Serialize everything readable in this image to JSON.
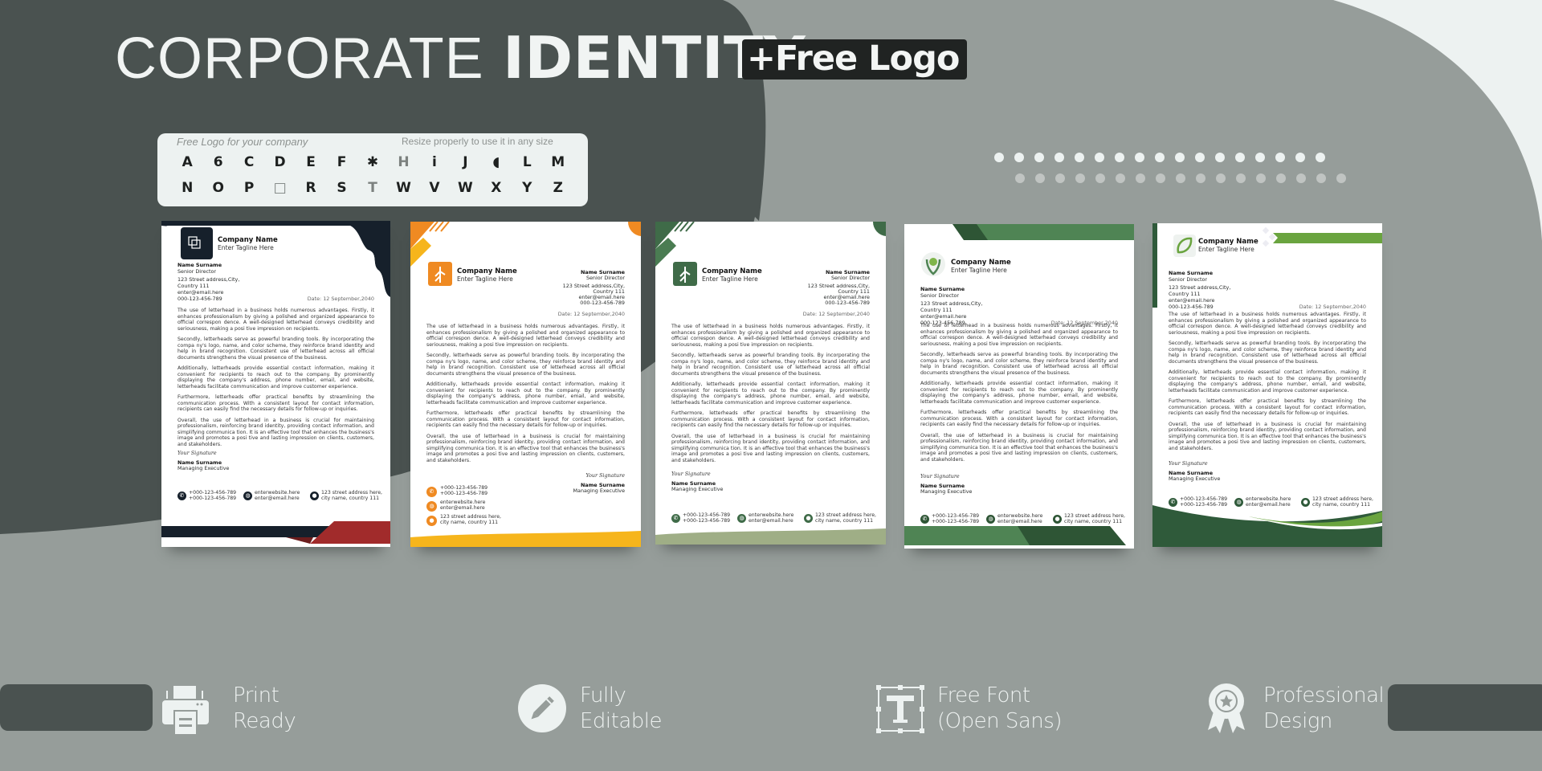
{
  "header": {
    "title_light": "CORPORATE",
    "title_bold": "IDENTITY",
    "badge": "+Free Logo"
  },
  "colors": {
    "background_dark": "#4a5250",
    "background_mid": "#969d9a",
    "background_light": "#edf2f1",
    "badge_bg": "#202322"
  },
  "logo_panel": {
    "caption_left": "Free Logo for your company",
    "caption_right": "Resize properly to use it in any size",
    "logos": [
      {
        "icon": "a-triangle-logo",
        "glyph": "A"
      },
      {
        "icon": "b-swirl-logo",
        "glyph": "6"
      },
      {
        "icon": "c-moon-logo",
        "glyph": "C"
      },
      {
        "icon": "d-outline-logo",
        "glyph": "D"
      },
      {
        "icon": "e-stripes-logo",
        "glyph": "E"
      },
      {
        "icon": "f-block-logo",
        "glyph": "F"
      },
      {
        "icon": "flower-logo",
        "glyph": "✱"
      },
      {
        "icon": "h-block-logo",
        "glyph": "H"
      },
      {
        "icon": "i-circle-logo",
        "glyph": "i"
      },
      {
        "icon": "j-logo",
        "glyph": "J"
      },
      {
        "icon": "k-half-circle-logo",
        "glyph": "◖"
      },
      {
        "icon": "l-curve-logo",
        "glyph": "L"
      },
      {
        "icon": "m-stripes-logo",
        "glyph": "M"
      },
      {
        "icon": "n-arrows-logo",
        "glyph": "N"
      },
      {
        "icon": "o-ring-logo",
        "glyph": "O"
      },
      {
        "icon": "p-logo",
        "glyph": "P"
      },
      {
        "icon": "q-square-logo",
        "glyph": "□"
      },
      {
        "icon": "r-oval-logo",
        "glyph": "R"
      },
      {
        "icon": "s-logo",
        "glyph": "S"
      },
      {
        "icon": "t-logo",
        "glyph": "T"
      },
      {
        "icon": "u-stripes-logo",
        "glyph": "W"
      },
      {
        "icon": "v-heart-logo",
        "glyph": "V"
      },
      {
        "icon": "w-logo",
        "glyph": "W"
      },
      {
        "icon": "x-logo",
        "glyph": "X"
      },
      {
        "icon": "y-logo",
        "glyph": "Y"
      },
      {
        "icon": "z-logo",
        "glyph": "Z"
      }
    ]
  },
  "letterheads": [
    {
      "theme": "navy-red",
      "accent": "#16202b",
      "accent2": "#a12b2b",
      "company": "Company Name",
      "tagline": "Enter Tagline Here",
      "sender_name": "Name Surname",
      "sender_title": "Senior Director",
      "address_1": "123 Street address,City,",
      "address_2": "Country 111",
      "email": "enter@email.here",
      "phone": "000-123-456-789",
      "date": "Date: 12 September,2040",
      "signature": "Your Signature",
      "sign_name": "Name Surname",
      "sign_title": "Managing Executive",
      "contact_phone_1": "+000-123-456-789",
      "contact_phone_2": "+000-123-456-789",
      "contact_web": "enterwebsite.here",
      "contact_email": "enter@email.here",
      "contact_addr_1": "123 street address here,",
      "contact_addr_2": "city name, country 111"
    },
    {
      "theme": "orange",
      "accent": "#ef8a22",
      "accent2": "#f6b51c",
      "company": "Company Name",
      "tagline": "Enter Tagline Here",
      "sender_name": "Name Surname",
      "sender_title": "Senior Director",
      "address_1": "123 Street address,City,",
      "address_2": "Country 111",
      "email": "enter@email.here",
      "phone": "000-123-456-789",
      "date": "Date: 12 September,2040",
      "signature": "Your Signature",
      "sign_name": "Name Surname",
      "sign_title": "Managing Executive",
      "contact_phone_1": "+000-123-456-789",
      "contact_phone_2": "+000-123-456-789",
      "contact_web": "enterwebsite.here",
      "contact_email": "enter@email.here",
      "contact_addr_1": "123 street address here,",
      "contact_addr_2": "city name, country 111"
    },
    {
      "theme": "sage-green",
      "accent": "#3f6b48",
      "accent2": "#9fae86",
      "company": "Company Name",
      "tagline": "Enter Tagline Here",
      "sender_name": "Name Surname",
      "sender_title": "Senior Director",
      "address_1": "123 Street address,City,",
      "address_2": "Country 111",
      "email": "enter@email.here",
      "phone": "000-123-456-789",
      "date": "Date: 12 September,2040",
      "signature": "Your Signature",
      "sign_name": "Name Surname",
      "sign_title": "Managing Executive",
      "contact_phone_1": "+000-123-456-789",
      "contact_phone_2": "+000-123-456-789",
      "contact_web": "enterwebsite.here",
      "contact_email": "enter@email.here",
      "contact_addr_1": "123 street address here,",
      "contact_addr_2": "city name, country 111"
    },
    {
      "theme": "forest-green",
      "accent": "#4f8454",
      "accent2": "#2e5535",
      "company": "Company Name",
      "tagline": "Enter Tagline Here",
      "sender_name": "Name Surname",
      "sender_title": "Senior Director",
      "address_1": "123 Street address,City,",
      "address_2": "Country 111",
      "email": "enter@email.here",
      "phone": "000-123-456-789",
      "date": "Date: 12 September,2040",
      "signature": "Your Signature",
      "sign_name": "Name Surname",
      "sign_title": "Managing Executive",
      "contact_phone_1": "+000-123-456-789",
      "contact_phone_2": "+000-123-456-789",
      "contact_web": "enterwebsite.here",
      "contact_email": "enter@email.here",
      "contact_addr_1": "123 street address here,",
      "contact_addr_2": "city name, country 111"
    },
    {
      "theme": "leaf-green",
      "accent": "#2f5a3a",
      "accent2": "#6aa43f",
      "company": "Company Name",
      "tagline": "Enter Tagline Here",
      "sender_name": "Name Surname",
      "sender_title": "Senior Director",
      "address_1": "123 Street address,City,",
      "address_2": "Country 111",
      "email": "enter@email.here",
      "phone": "000-123-456-789",
      "date": "Date: 12 September,2040",
      "signature": "Your Signature",
      "sign_name": "Name Surname",
      "sign_title": "Managing Executive",
      "contact_phone_1": "+000-123-456-789",
      "contact_phone_2": "+000-123-456-789",
      "contact_web": "enterwebsite.here",
      "contact_email": "enter@email.here",
      "contact_addr_1": "123 street address here,",
      "contact_addr_2": "city name, country 111"
    }
  ],
  "letter_body": [
    "The use of letterhead in a business holds numerous advantages. Firstly, it enhances professionalism by giving a polished and organized appearance to official correspon dence. A well-designed letterhead conveys credibility and seriousness, making a posi tive impression on recipients.",
    "Secondly, letterheads serve as powerful branding tools. By incorporating the compa ny's logo, name, and color scheme, they reinforce brand identity and help in brand recognition. Consistent use of letterhead across all official documents strengthens the visual presence of the business.",
    "Additionally, letterheads provide essential contact information, making it convenient for recipients to reach out to the company. By prominently displaying the company's address, phone number, email, and website, letterheads facilitate communication and improve customer experience.",
    "Furthermore, letterheads offer practical benefits by streamlining the communication process. With a consistent layout for contact information, recipients can easily find the necessary details for follow-up or inquiries.",
    "Overall, the use of letterhead in a business is crucial for maintaining professionalism, reinforcing brand identity, providing contact information, and simplifying communica tion. It is an effective tool that enhances the business's image and promotes a posi tive and lasting impression on clients, customers, and stakeholders."
  ],
  "features": [
    {
      "icon": "printer-icon",
      "line1": "Print",
      "line2": "Ready"
    },
    {
      "icon": "pencil-icon",
      "line1": "Fully",
      "line2": "Editable"
    },
    {
      "icon": "text-font-icon",
      "line1": "Free Font",
      "line2": "(Open Sans)"
    },
    {
      "icon": "award-badge-icon",
      "line1": "Professional",
      "line2": "Design"
    }
  ]
}
